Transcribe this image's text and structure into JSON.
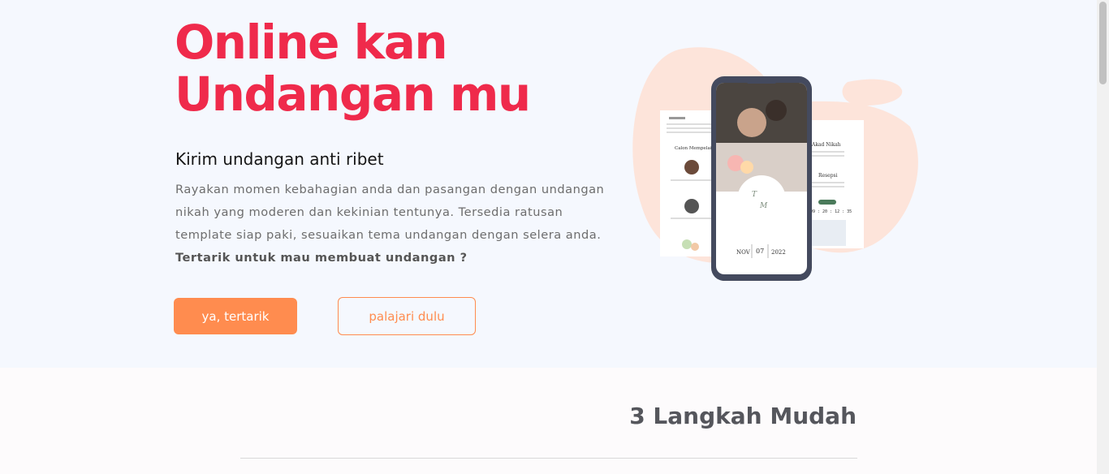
{
  "hero": {
    "title_line1": "Online kan",
    "title_line2": "Undangan mu",
    "subtitle": "Kirim undangan anti ribet",
    "description": "Rayakan momen kebahagian anda dan pasangan dengan undangan nikah yang moderen dan kekinian tentunya. Tersedia ratusan template siap paki, sesuaikan tema undangan dengan selera anda.",
    "description_bold": "Tertarik untuk mau membuat undangan ?",
    "primary_button": "ya, tertarik",
    "secondary_button": "palajari dulu"
  },
  "illustration": {
    "left_card_heading": "Calon Mempelai Wanita",
    "right_card_heading1": "Akad Nikah",
    "right_card_heading2": "Resepsi",
    "countdown": "09 : 20 : 12 : 35",
    "phone_month": "NOV",
    "phone_day": "07",
    "phone_year": "2022"
  },
  "steps": {
    "title": "3 Langkah Mudah"
  },
  "colors": {
    "accent_red": "#ef2a4b",
    "accent_orange": "#ff8c4f",
    "hero_bg": "#f5f8fe"
  }
}
